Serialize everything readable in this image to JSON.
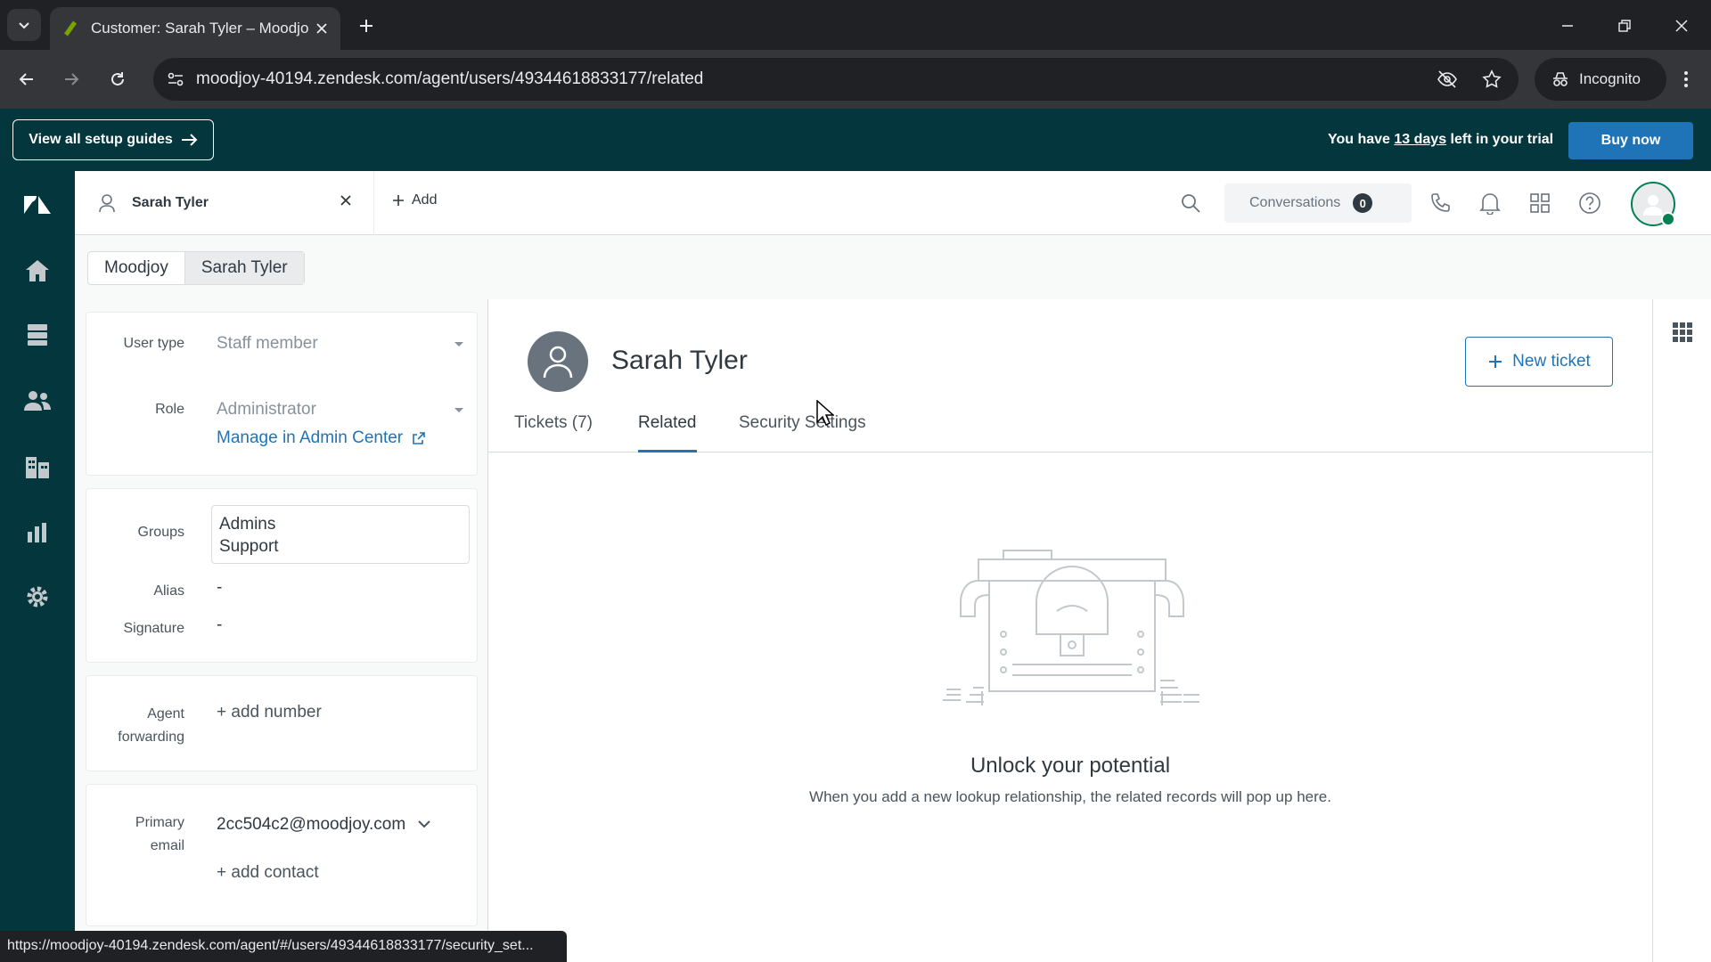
{
  "browser": {
    "tab_title": "Customer: Sarah Tyler – Moodjoy",
    "url": "moodjoy-40194.zendesk.com/agent/users/49344618833177/related",
    "incognito_label": "Incognito",
    "status_url": "https://moodjoy-40194.zendesk.com/agent/#/users/49344618833177/security_set..."
  },
  "banner": {
    "guides_label": "View all setup guides",
    "trial_prefix": "You have ",
    "trial_days": "13 days",
    "trial_suffix": " left in your trial",
    "buy_label": "Buy now"
  },
  "appbar": {
    "user_tab_label": "Sarah Tyler",
    "add_label": "Add",
    "conversations_label": "Conversations",
    "conversations_count": "0"
  },
  "breadcrumb": [
    "Moodjoy",
    "Sarah Tyler"
  ],
  "properties": {
    "user_type_label": "User type",
    "user_type_value": "Staff member",
    "role_label": "Role",
    "role_value": "Administrator",
    "admin_link": "Manage in Admin Center",
    "groups_label": "Groups",
    "groups": [
      "Admins",
      "Support"
    ],
    "alias_label": "Alias",
    "alias_value": "-",
    "signature_label": "Signature",
    "signature_value": "-",
    "forwarding_label_1": "Agent",
    "forwarding_label_2": "forwarding",
    "add_number": "+ add number",
    "primary_label_1": "Primary",
    "primary_label_2": "email",
    "primary_email": "2cc504c2@moodjoy.com",
    "add_contact": "+ add contact"
  },
  "main": {
    "user_name": "Sarah Tyler",
    "new_ticket_label": "New ticket",
    "tabs": [
      {
        "label": "Tickets (7)",
        "active": false
      },
      {
        "label": "Related",
        "active": true
      },
      {
        "label": "Security Settings",
        "active": false
      }
    ],
    "empty_title": "Unlock your potential",
    "empty_desc": "When you add a new lookup relationship, the related records will pop up here."
  },
  "colors": {
    "brand_dark": "#03363d",
    "accent_blue": "#1f73b7",
    "online_green": "#038153"
  }
}
